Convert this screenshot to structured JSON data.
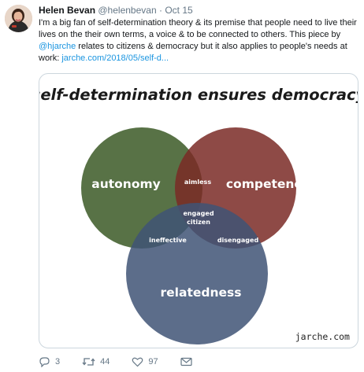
{
  "tweet": {
    "author_name": "Helen Bevan",
    "author_handle": "@helenbevan",
    "separator": "·",
    "date": "Oct 15",
    "avatar_icon": "profile-photo",
    "text_before_mention": "I'm a big fan of self-determination theory & its premise that people need to live their lives on the their own terms, a voice & to be connected to others. This piece by ",
    "mention": "@hjarche",
    "text_after_mention": " relates to citizens & democracy but it also applies to people's needs at work: ",
    "link": "jarche.com/2018/05/self-d..."
  },
  "diagram": {
    "title": "self-determination ensures democracy",
    "circles": {
      "autonomy": {
        "label": "autonomy",
        "color": "#4f6a3c"
      },
      "competence": {
        "label": "competence",
        "color": "#7a2a26"
      },
      "relatedness": {
        "label": "relatedness",
        "color": "#3f5376"
      }
    },
    "overlaps": {
      "autonomy_competence": "aimless",
      "autonomy_relatedness": "ineffective",
      "competence_relatedness": "disengaged",
      "center_line1": "engaged",
      "center_line2": "citizen"
    },
    "credit": "jarche.com"
  },
  "actions": {
    "reply": {
      "icon": "reply-icon",
      "count": "3"
    },
    "retweet": {
      "icon": "retweet-icon",
      "count": "44"
    },
    "like": {
      "icon": "heart-icon",
      "count": "97"
    },
    "dm": {
      "icon": "envelope-icon"
    }
  },
  "colors": {
    "link": "#1b95e0",
    "secondary_text": "#657786",
    "border": "#ccd6dd"
  }
}
